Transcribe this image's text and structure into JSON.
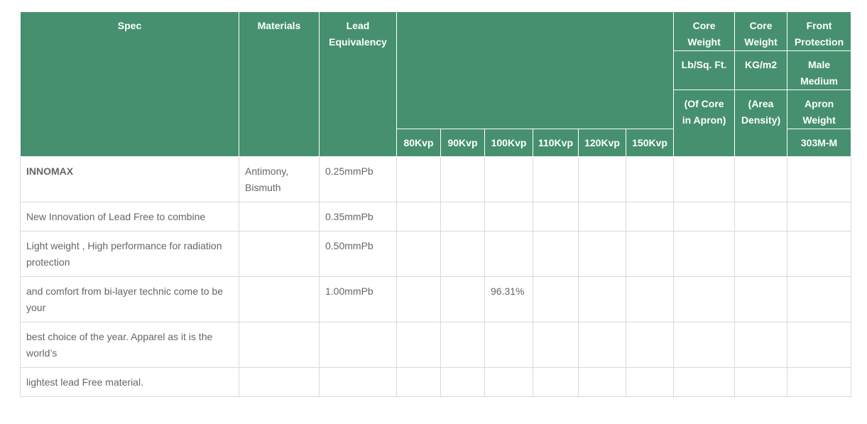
{
  "header": {
    "spec": "Spec",
    "materials": "Materials",
    "lead_equivalency": "Lead Equivalency",
    "kvp": [
      "80Kvp",
      "90Kvp",
      "100Kvp",
      "110Kvp",
      "120Kvp",
      "150Kvp"
    ],
    "core_weight_1": [
      "Core Weight",
      "Lb/Sq. Ft.",
      "(Of Core in Apron)"
    ],
    "core_weight_2": [
      "Core Weight",
      "KG/m2",
      "(Area Density)"
    ],
    "front_protection": [
      "Front Protection",
      "Male Medium",
      "Apron Weight",
      "303M-M"
    ]
  },
  "rows": [
    {
      "spec": "INNOMAX",
      "materials": "Antimony, Bismuth",
      "lead": "0.25mmPb",
      "kvp": [
        "",
        "",
        "",
        "",
        "",
        ""
      ]
    },
    {
      "spec": "New  Innovation of Lead Free  to combine",
      "materials": "",
      "lead": "0.35mmPb",
      "kvp": [
        "",
        "",
        "",
        "",
        "",
        ""
      ]
    },
    {
      "spec": "Light weight , High performance for radiation protection",
      "materials": "",
      "lead": "0.50mmPb",
      "kvp": [
        "",
        "",
        "",
        "",
        "",
        ""
      ]
    },
    {
      "spec": "and comfort from bi-layer technic  come to be your",
      "materials": "",
      "lead": "1.00mmPb",
      "kvp": [
        "",
        "",
        "96.31%",
        "",
        "",
        ""
      ]
    },
    {
      "spec": "best choice of the year. Apparel as it is the world’s",
      "materials": "",
      "lead": "",
      "kvp": [
        "",
        "",
        "",
        "",
        "",
        ""
      ]
    },
    {
      "spec": "lightest lead Free material.",
      "materials": "",
      "lead": "",
      "kvp": [
        "",
        "",
        "",
        "",
        "",
        ""
      ]
    }
  ]
}
